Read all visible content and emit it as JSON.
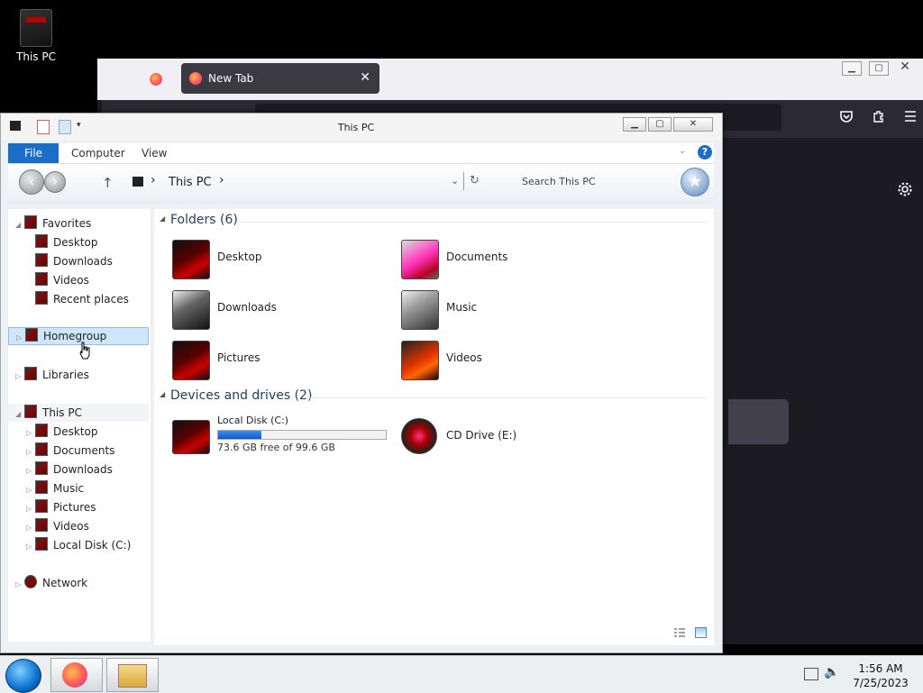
{
  "desktop": {
    "icons": [
      {
        "label": "This PC"
      }
    ]
  },
  "firefox": {
    "tab": {
      "title": "New Tab",
      "close": "✕"
    },
    "window": {
      "min": "▁",
      "max": "▢",
      "close": "✕"
    }
  },
  "explorer": {
    "title": "This PC",
    "window": {
      "min": "▁",
      "max": "▢",
      "close": "✕"
    },
    "ribbon": {
      "file": "File",
      "computer": "Computer",
      "view": "View",
      "help": "?"
    },
    "address": {
      "crumb": "This PC",
      "sep1": "›",
      "sep2": "›",
      "search_placeholder": "Search This PC"
    },
    "nav": {
      "favorites": "Favorites",
      "fav_items": [
        "Desktop",
        "Downloads",
        "Videos",
        "Recent places"
      ],
      "homegroup": "Homegroup",
      "libraries": "Libraries",
      "thispc": "This PC",
      "pc_items": [
        "Desktop",
        "Documents",
        "Downloads",
        "Music",
        "Pictures",
        "Videos",
        "Local Disk (C:)"
      ],
      "network": "Network"
    },
    "folders_header": "Folders (6)",
    "folders": [
      "Desktop",
      "Documents",
      "Downloads",
      "Music",
      "Pictures",
      "Videos"
    ],
    "devices_header": "Devices and drives (2)",
    "drives": [
      {
        "name": "Local Disk (C:)",
        "free": "73.6 GB free of 99.6 GB",
        "used_fraction": 0.26
      },
      {
        "name": "CD Drive (E:)"
      }
    ]
  },
  "taskbar": {
    "time": "1:56 AM",
    "date": "7/25/2023"
  },
  "colors": {
    "file_tab": "#1a6dc9",
    "accent": "#c00000",
    "selection": "#cde6fb"
  }
}
